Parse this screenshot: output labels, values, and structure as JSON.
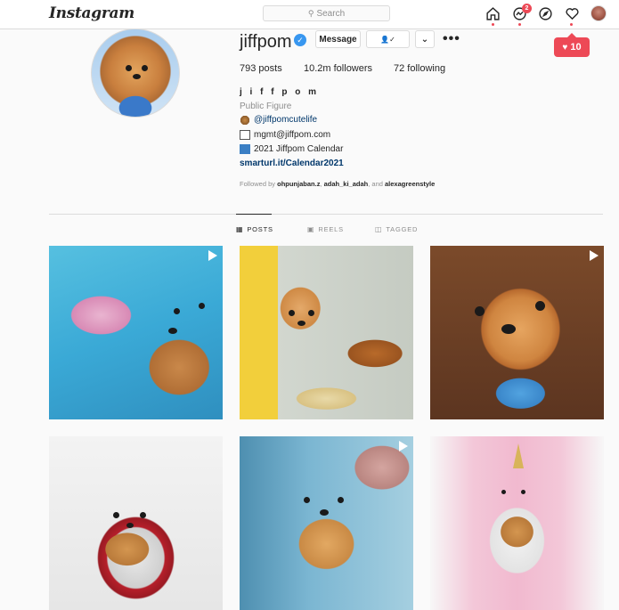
{
  "nav": {
    "logo": "Instagram",
    "search_placeholder": "Search",
    "messages_badge": "2",
    "notification_count": "10"
  },
  "profile": {
    "username": "jiffpom",
    "verified_icon": "✓",
    "message_button": "Message",
    "follow_icon": "👤✓",
    "dropdown_icon": "⌄",
    "more_icon": "•••",
    "stats": {
      "posts": "793 posts",
      "followers": "10.2m followers",
      "following": "72 following"
    },
    "full_name": "j i f f p o m",
    "category": "Public Figure",
    "bio": [
      {
        "emoji": "dog-emoji",
        "text": "@jiffpomcutelife",
        "type": "link"
      },
      {
        "emoji": "envelope-emoji",
        "text": "mgmt@jiffpom.com",
        "type": "text"
      },
      {
        "emoji": "arrow-emoji",
        "text": "2021 Jiffpom Calendar",
        "type": "text"
      }
    ],
    "url": "smarturl.it/Calendar2021",
    "followed_by_prefix": "Followed by ",
    "followed_by_users": [
      "ohpunjaban.z",
      "adah_ki_adah"
    ],
    "followed_by_suffix": ", and ",
    "followed_by_last": "alexagreenstyle"
  },
  "tabs": [
    {
      "icon": "grid-icon",
      "label": "POSTS",
      "active": true
    },
    {
      "icon": "reels-icon",
      "label": "REELS",
      "active": false
    },
    {
      "icon": "tagged-icon",
      "label": "TAGGED",
      "active": false
    }
  ],
  "colors": {
    "accent_red": "#ed4956",
    "link_blue": "#00376b",
    "verified_blue": "#3897f0"
  }
}
